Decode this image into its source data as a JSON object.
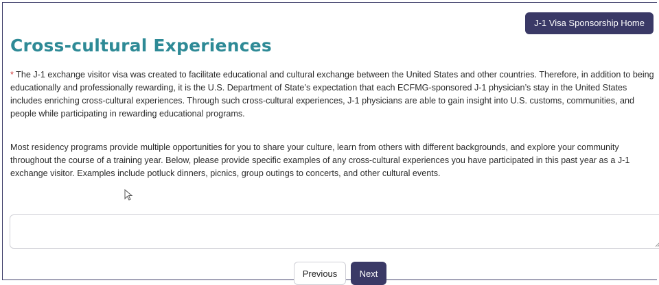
{
  "header": {
    "home_button_label": "J-1 Visa Sponsorship Home"
  },
  "main": {
    "title": "Cross-cultural Experiences",
    "required_marker": "*",
    "intro_paragraph": " The J-1 exchange visitor visa was created to facilitate educational and cultural exchange between the United States and other countries. Therefore, in addition to being educationally and professionally rewarding, it is the U.S. Department of State’s expectation that each ECFMG-sponsored J-1 physician’s stay in the United States includes enriching cross-cultural experiences. Through such cross-cultural experiences, J-1 physicians are able to gain insight into U.S. customs, communities, and people while participating in rewarding educational programs.",
    "instruction_paragraph": "Most residency programs provide multiple opportunities for you to share your culture, learn from others with different backgrounds, and explore your community throughout the course of a training year. Below, please provide specific examples of any cross-cultural experiences you have participated in this past year as a J-1 exchange visitor. Examples include potluck dinners, picnics, group outings to concerts, and other cultural events.",
    "answer_value": ""
  },
  "navigation": {
    "previous_label": "Previous",
    "next_label": "Next"
  },
  "colors": {
    "accent": "#3a3966",
    "title": "#2e8a96",
    "required": "#d04040"
  },
  "icons": {
    "cursor": "mouse-pointer-icon",
    "grip": "resize-grip-icon"
  }
}
